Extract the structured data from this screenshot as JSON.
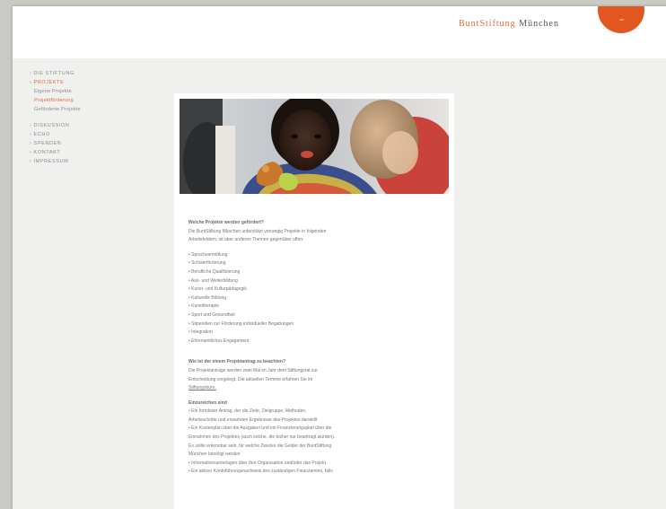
{
  "header": {
    "brand": "BuntStiftung",
    "city": "München"
  },
  "nav": {
    "groups": [
      [
        {
          "label": "› DIE STIFTUNG"
        },
        {
          "label": "› PROJEKTE"
        },
        {
          "label": "Eigene Projekte"
        },
        {
          "label": "Projektförderung"
        },
        {
          "label": "Geförderte Projekte"
        }
      ],
      [
        {
          "label": "› DISKUSSION"
        },
        {
          "label": "› ECHO"
        },
        {
          "label": "› SPENDEN"
        },
        {
          "label": "› KONTAKT"
        },
        {
          "label": "› IMPRESSUM"
        }
      ]
    ]
  },
  "content": {
    "section1_heading": "Welche Projekte werden gefördert?",
    "section1_intro_1": "Die BuntStiftung München unterstützt vorrangig Projekte in folgenden",
    "section1_intro_2": "Arbeitsfeldern, ist aber anderen Themen gegenüber offen:",
    "areas": [
      "• Sprachvermittlung",
      "• Schülerförderung",
      "• Berufliche Qualifizierung",
      "• Aus- und Weiterbildung",
      "• Kunst- und Kulturpädagogik",
      "• Kulturelle Bildung",
      "• Kunsttherapie",
      "• Sport und Gesundheit",
      "• Stipendien zur Förderung individueller Begabungen",
      "• Integration",
      "• Ehrenamtliches Engagement"
    ],
    "section2_heading": "Wie ist der einem Projektantrag zu beachten?",
    "section2_text_1": "Die Projektanträge werden zwei Mal im Jahr dem Stiftungsrat zur",
    "section2_text_2": "Entscheidung vorgelegt. Die aktuellen Termine erfahren Sie im",
    "section2_link": "Stiftungsbüro.",
    "section3_heading": "Einzureichen sind",
    "section3_lines": [
      "• Ein formloser Antrag, der die Ziele, Zielgruppe, Methoden,",
      "Arbeitsschritte und erwarteten Ergebnisse des Projektes darstellt",
      "• Ein Kostenplan über die Ausgaben und ein Finanzierungsplan über die",
      "Einnahmen des Projektes (auch solche, die bisher nur beantragt wurden).",
      "Es sollte erkennbar sein, für welche Zwecke die Gelder der BuntStiftung",
      "München benötigt werden",
      "• Informationsunterlagen über Ihre Organisation und/oder das Projekt",
      "• Ein aktiver Kontoführungsnachweis des zuständigen Finanzamtes, falls"
    ]
  },
  "colors": {
    "accent": "#e06b3a",
    "circle": "#e2561f",
    "background": "#c9cac4",
    "page": "#f0f0ef"
  }
}
